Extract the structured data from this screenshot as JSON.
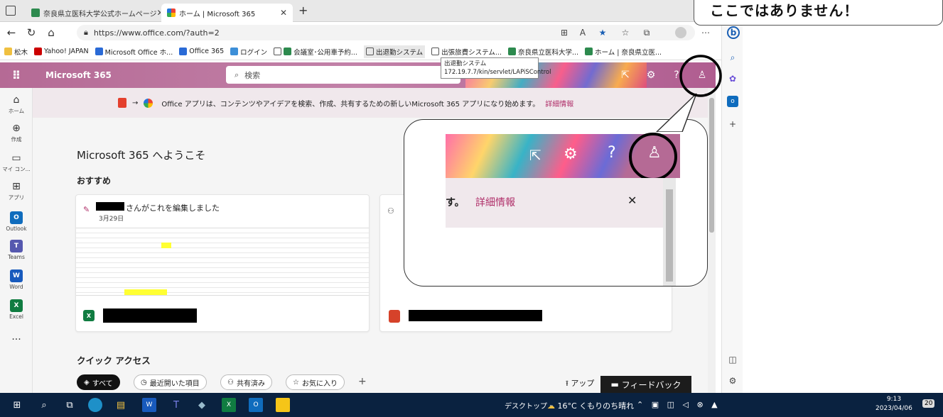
{
  "annotation": "ここではありません！",
  "tabs": [
    {
      "label": "奈良県立医科大学公式ホームページ",
      "active": false
    },
    {
      "label": "ホーム | Microsoft 365",
      "active": true
    }
  ],
  "new_tab": "+",
  "address": {
    "url": "https://www.office.com/?auth=2"
  },
  "bookmarks": [
    "松木",
    "Yahoo! JAPAN",
    "Microsoft Office ホ...",
    "Office 365",
    "ログイン",
    "会議室･公用車予約...",
    "出退勤システム",
    "出張旅費システム...",
    "奈良県立医科大学...",
    "ホーム | 奈良県立医..."
  ],
  "tooltip": {
    "line1": "出退勤システム",
    "line2": "172.19.7.7/kin/servlet/LAPiSControl"
  },
  "header": {
    "app_name": "Microsoft 365",
    "search_placeholder": "検索",
    "waffle": "⠿"
  },
  "banner": {
    "text": "Office アプリは、コンテンツやアイデアを検索、作成、共有するための新しいMicrosoft 365 アプリになり始めます。",
    "link": "詳細情報",
    "close": "✕"
  },
  "rail": [
    {
      "label": "ホーム",
      "glyph": "⌂"
    },
    {
      "label": "作成",
      "glyph": "⊕"
    },
    {
      "label": "マイ コン...",
      "glyph": "▭"
    },
    {
      "label": "アプリ",
      "glyph": "⊞"
    },
    {
      "label": "Outlook",
      "glyph": "O"
    },
    {
      "label": "Teams",
      "glyph": "T"
    },
    {
      "label": "Word",
      "glyph": "W"
    },
    {
      "label": "Excel",
      "glyph": "X"
    },
    {
      "label": "",
      "glyph": "···"
    }
  ],
  "main": {
    "welcome": "Microsoft 365 へようこそ",
    "recommended": "おすすめ",
    "card1": {
      "action": "さんがこれを編集しました",
      "date": "3月29日"
    },
    "quick_access": "クイック アクセス",
    "filters": [
      "すべて",
      "最近開いた項目",
      "共有済み",
      "お気に入り"
    ],
    "add": "+",
    "upload": "アップ"
  },
  "callout": {
    "text": "す。",
    "link": "詳細情報",
    "close": "✕"
  },
  "feedback": "フィードバック",
  "taskbar": {
    "desktop": "デスクトップ",
    "weather": "16°C くもりのち晴れ",
    "time": "9:13",
    "date": "2023/04/06",
    "notif": "20"
  }
}
